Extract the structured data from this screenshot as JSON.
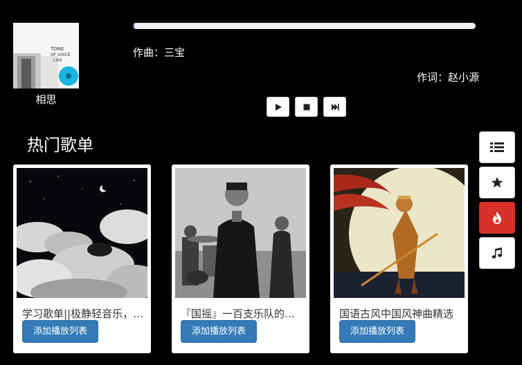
{
  "now_playing": {
    "song_title": "相思",
    "composer": "作曲：三宝",
    "lyricist": "作词：赵小源",
    "progress_fraction": 0.005
  },
  "controls": {
    "play_icon": "play-icon",
    "stop_icon": "stop-icon",
    "next_icon": "step-forward-icon"
  },
  "section": {
    "title": "热门歌单"
  },
  "playlists": [
    {
      "title": "学习歌单||极静轻音乐，舒缓身心",
      "button_label": "添加播放列表"
    },
    {
      "title": "『国摇』一百支乐队的一百首歌",
      "button_label": "添加播放列表"
    },
    {
      "title": "国语古风中国风神曲精选",
      "button_label": "添加播放列表"
    }
  ],
  "sidebar": {
    "icons": [
      "list-icon",
      "star-icon",
      "fire-icon",
      "music-icon"
    ],
    "active_index": 2
  },
  "colors": {
    "background": "#000000",
    "primary": "#337ab7",
    "danger": "#d9302a"
  }
}
